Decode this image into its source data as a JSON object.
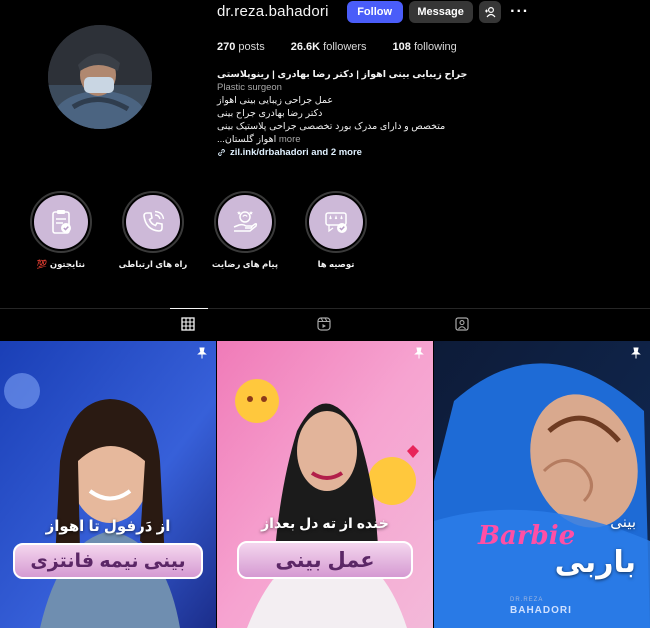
{
  "profile": {
    "username": "dr.reza.bahadori",
    "follow_label": "Follow",
    "message_label": "Message",
    "more_label": "···"
  },
  "stats": {
    "posts_count": "270",
    "posts_label": "posts",
    "followers_count": "26.6K",
    "followers_label": "followers",
    "following_count": "108",
    "following_label": "following"
  },
  "bio": {
    "name": "جراح زیبایی بینی اهواز | دکتر رضا بهادری | رینوپلاستی",
    "category": "Plastic surgeon",
    "lines": [
      "عمل جراحی زیبایی بینی اهواز",
      "دکتر رضا بهادری جراح بینی",
      "متخصص و دارای مدرک بورد تخصصی جراحی پلاستیک بینی"
    ],
    "last_line": "اهواز گلستان...",
    "more_label": "more",
    "link": "zil.ink/drbahadori and 2 more"
  },
  "highlights": [
    {
      "label": "نتایجتون 💯",
      "icon": "clipboard-check-icon"
    },
    {
      "label": "راه های ارتباطی",
      "icon": "phone-call-icon"
    },
    {
      "label": "پیام های رضایت",
      "icon": "hand-heart-icon"
    },
    {
      "label": "توصیه ها",
      "icon": "review-stars-icon"
    }
  ],
  "tabs": [
    {
      "name": "posts",
      "icon": "grid-icon",
      "active": true
    },
    {
      "name": "reels",
      "icon": "reels-icon",
      "active": false
    },
    {
      "name": "tagged",
      "icon": "tagged-icon",
      "active": false
    }
  ],
  "posts": [
    {
      "caption_top": "از دَرفول تا اهواز",
      "caption_main": "بینی نیمه فانتزی",
      "pinned": true
    },
    {
      "caption_top": "خنده از ته دل بعداز",
      "caption_main": "عمل بینی",
      "pinned": true
    },
    {
      "caption_top": "بینی",
      "caption_main": "باربی",
      "brand_script": "Barbie",
      "watermark_top": "DR.REZA",
      "watermark_bottom": "BAHADORI",
      "pinned": true
    }
  ],
  "colors": {
    "accent": "#4a5df9",
    "button_secondary": "#363636",
    "highlight_bg": "#cdb9d8"
  }
}
